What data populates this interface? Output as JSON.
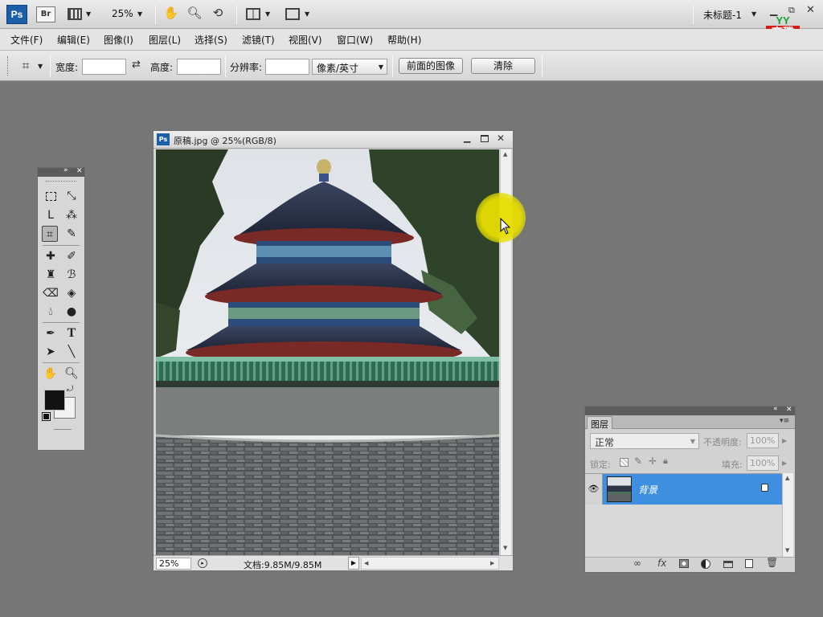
{
  "app": {
    "logo": "Ps",
    "bridge": "Br",
    "zoom": "25%",
    "doc_name": "未标题-1"
  },
  "brand": {
    "top": "YY",
    "line1": "育碟",
    "line2": "教育"
  },
  "menus": [
    "文件(F)",
    "编辑(E)",
    "图像(I)",
    "图层(L)",
    "选择(S)",
    "滤镜(T)",
    "视图(V)",
    "窗口(W)",
    "帮助(H)"
  ],
  "options": {
    "width_label": "宽度:",
    "width_value": "",
    "height_label": "高度:",
    "height_value": "",
    "resolution_label": "分辨率:",
    "resolution_value": "",
    "unit": "像素/英寸",
    "front_image_btn": "前面的图像",
    "clear_btn": "清除"
  },
  "document": {
    "title": "原稿.jpg @ 25%(RGB/8)",
    "zoom": "25%",
    "status": "文档:9.85M/9.85M"
  },
  "layers_panel": {
    "tab": "图层",
    "blend_mode": "正常",
    "opacity_label": "不透明度:",
    "opacity_value": "100%",
    "lock_label": "锁定:",
    "fill_label": "填充:",
    "fill_value": "100%",
    "layer_name": "背景"
  },
  "colors": {
    "foreground": "#121212",
    "background": "#f2f2f2",
    "selection": "#3f8fe0",
    "cursor_highlight": "#e6de00"
  }
}
